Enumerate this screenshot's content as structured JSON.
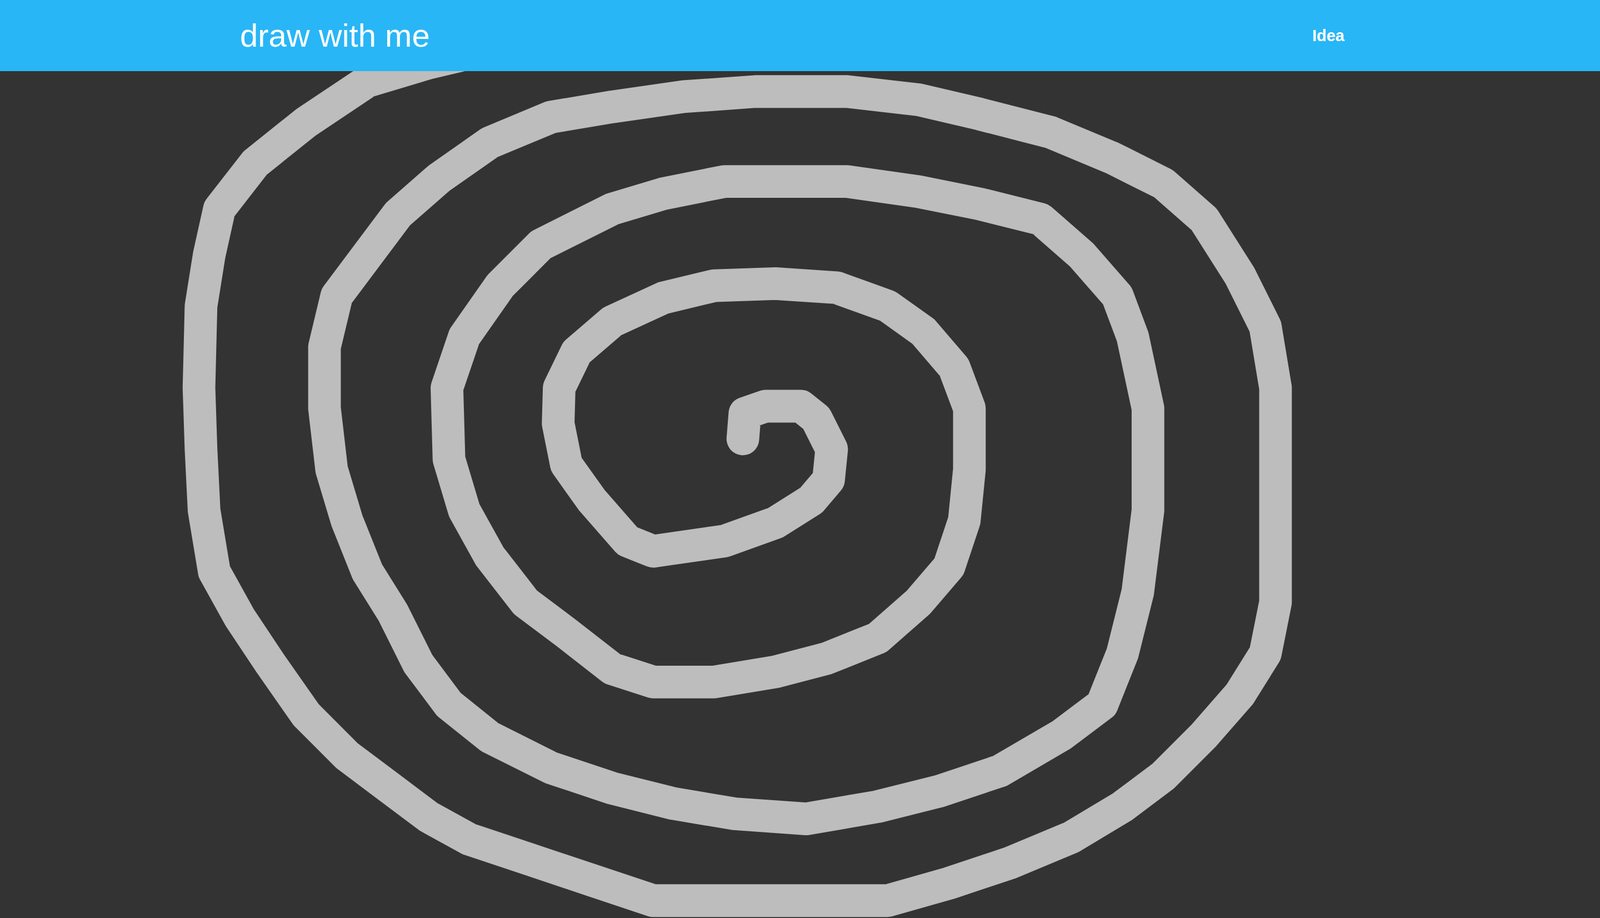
{
  "header": {
    "title": "draw with me"
  },
  "nav": [
    {
      "label": "Idea"
    }
  ]
}
